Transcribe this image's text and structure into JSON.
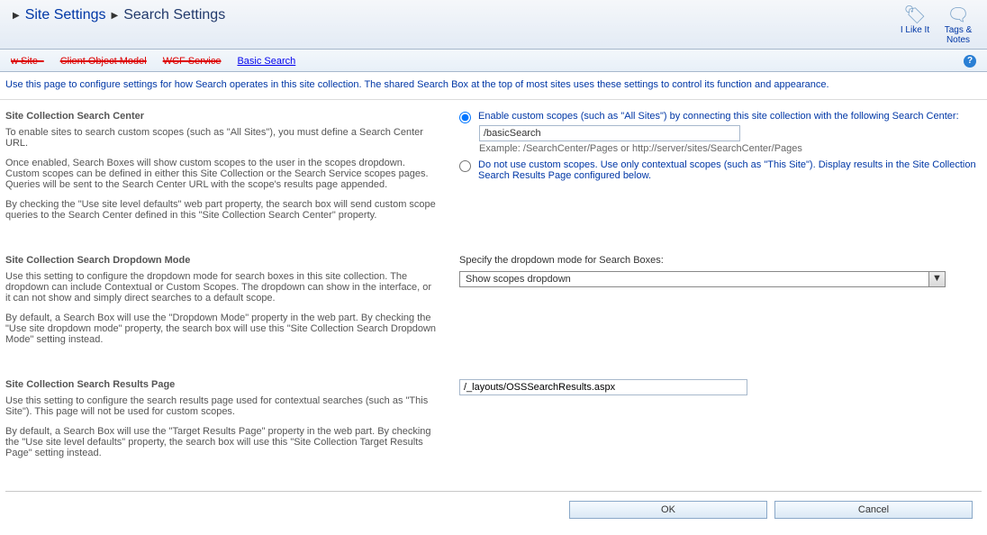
{
  "header": {
    "breadcrumb_parent": "Site Settings",
    "breadcrumb_current": "Search Settings",
    "like_label": "I Like It",
    "tags_label": "Tags &\nNotes"
  },
  "subnav": {
    "struck1": "w Site -",
    "struck2": "Client Object Model",
    "struck3": "WCF Service",
    "basic": "Basic Search"
  },
  "intro": "Use this page to configure settings for how Search operates in this site collection.  The shared Search Box at the top of most sites uses these settings to control its function and appearance.",
  "section1": {
    "title": "Site Collection Search Center",
    "p1": "To enable sites to search custom scopes (such as \"All Sites\"), you must define a Search Center URL.",
    "p2": "Once enabled, Search Boxes will show custom scopes to the user in the scopes dropdown.  Custom scopes can be defined in either this Site Collection or the Search Service scopes pages.  Queries will be sent to the Search Center URL with the scope's results page appended.",
    "p3": "By checking the \"Use site level defaults\" web part property, the search box will send custom scope queries to the Search Center defined in this \"Site Collection Search Center\" property.",
    "opt1": "Enable custom scopes (such as \"All Sites\") by connecting this site collection with the following Search Center:",
    "search_center_value": "/basicSearch",
    "example": "Example: /SearchCenter/Pages or http://server/sites/SearchCenter/Pages",
    "opt2": "Do not use custom scopes. Use only contextual scopes (such as \"This Site\"). Display results in the Site Collection Search Results Page configured below."
  },
  "section2": {
    "title": "Site Collection Search Dropdown Mode",
    "p1": "Use this setting to configure the dropdown mode for search boxes in this site collection.  The dropdown can include Contextual or Custom Scopes.  The dropdown can show in the interface, or it can not show and simply direct searches to a default scope.",
    "p2": "By default, a Search Box will use the \"Dropdown Mode\" property in the web part.  By checking the \"Use site dropdown mode\" property, the search box will use this \"Site Collection Search Dropdown Mode\" setting instead.",
    "label": "Specify the dropdown mode for Search Boxes:",
    "selected": "Show scopes dropdown"
  },
  "section3": {
    "title": "Site Collection Search Results Page",
    "p1": "Use this setting to configure the search results page used for contextual searches (such as \"This Site\").  This page will not be used for custom scopes.",
    "p2": "By default, a Search Box will use the \"Target Results Page\" property in the web part. By checking the \"Use site level defaults\" property, the search box will use this \"Site Collection Target Results Page\" setting instead.",
    "value": "/_layouts/OSSSearchResults.aspx"
  },
  "footer": {
    "ok": "OK",
    "cancel": "Cancel"
  }
}
